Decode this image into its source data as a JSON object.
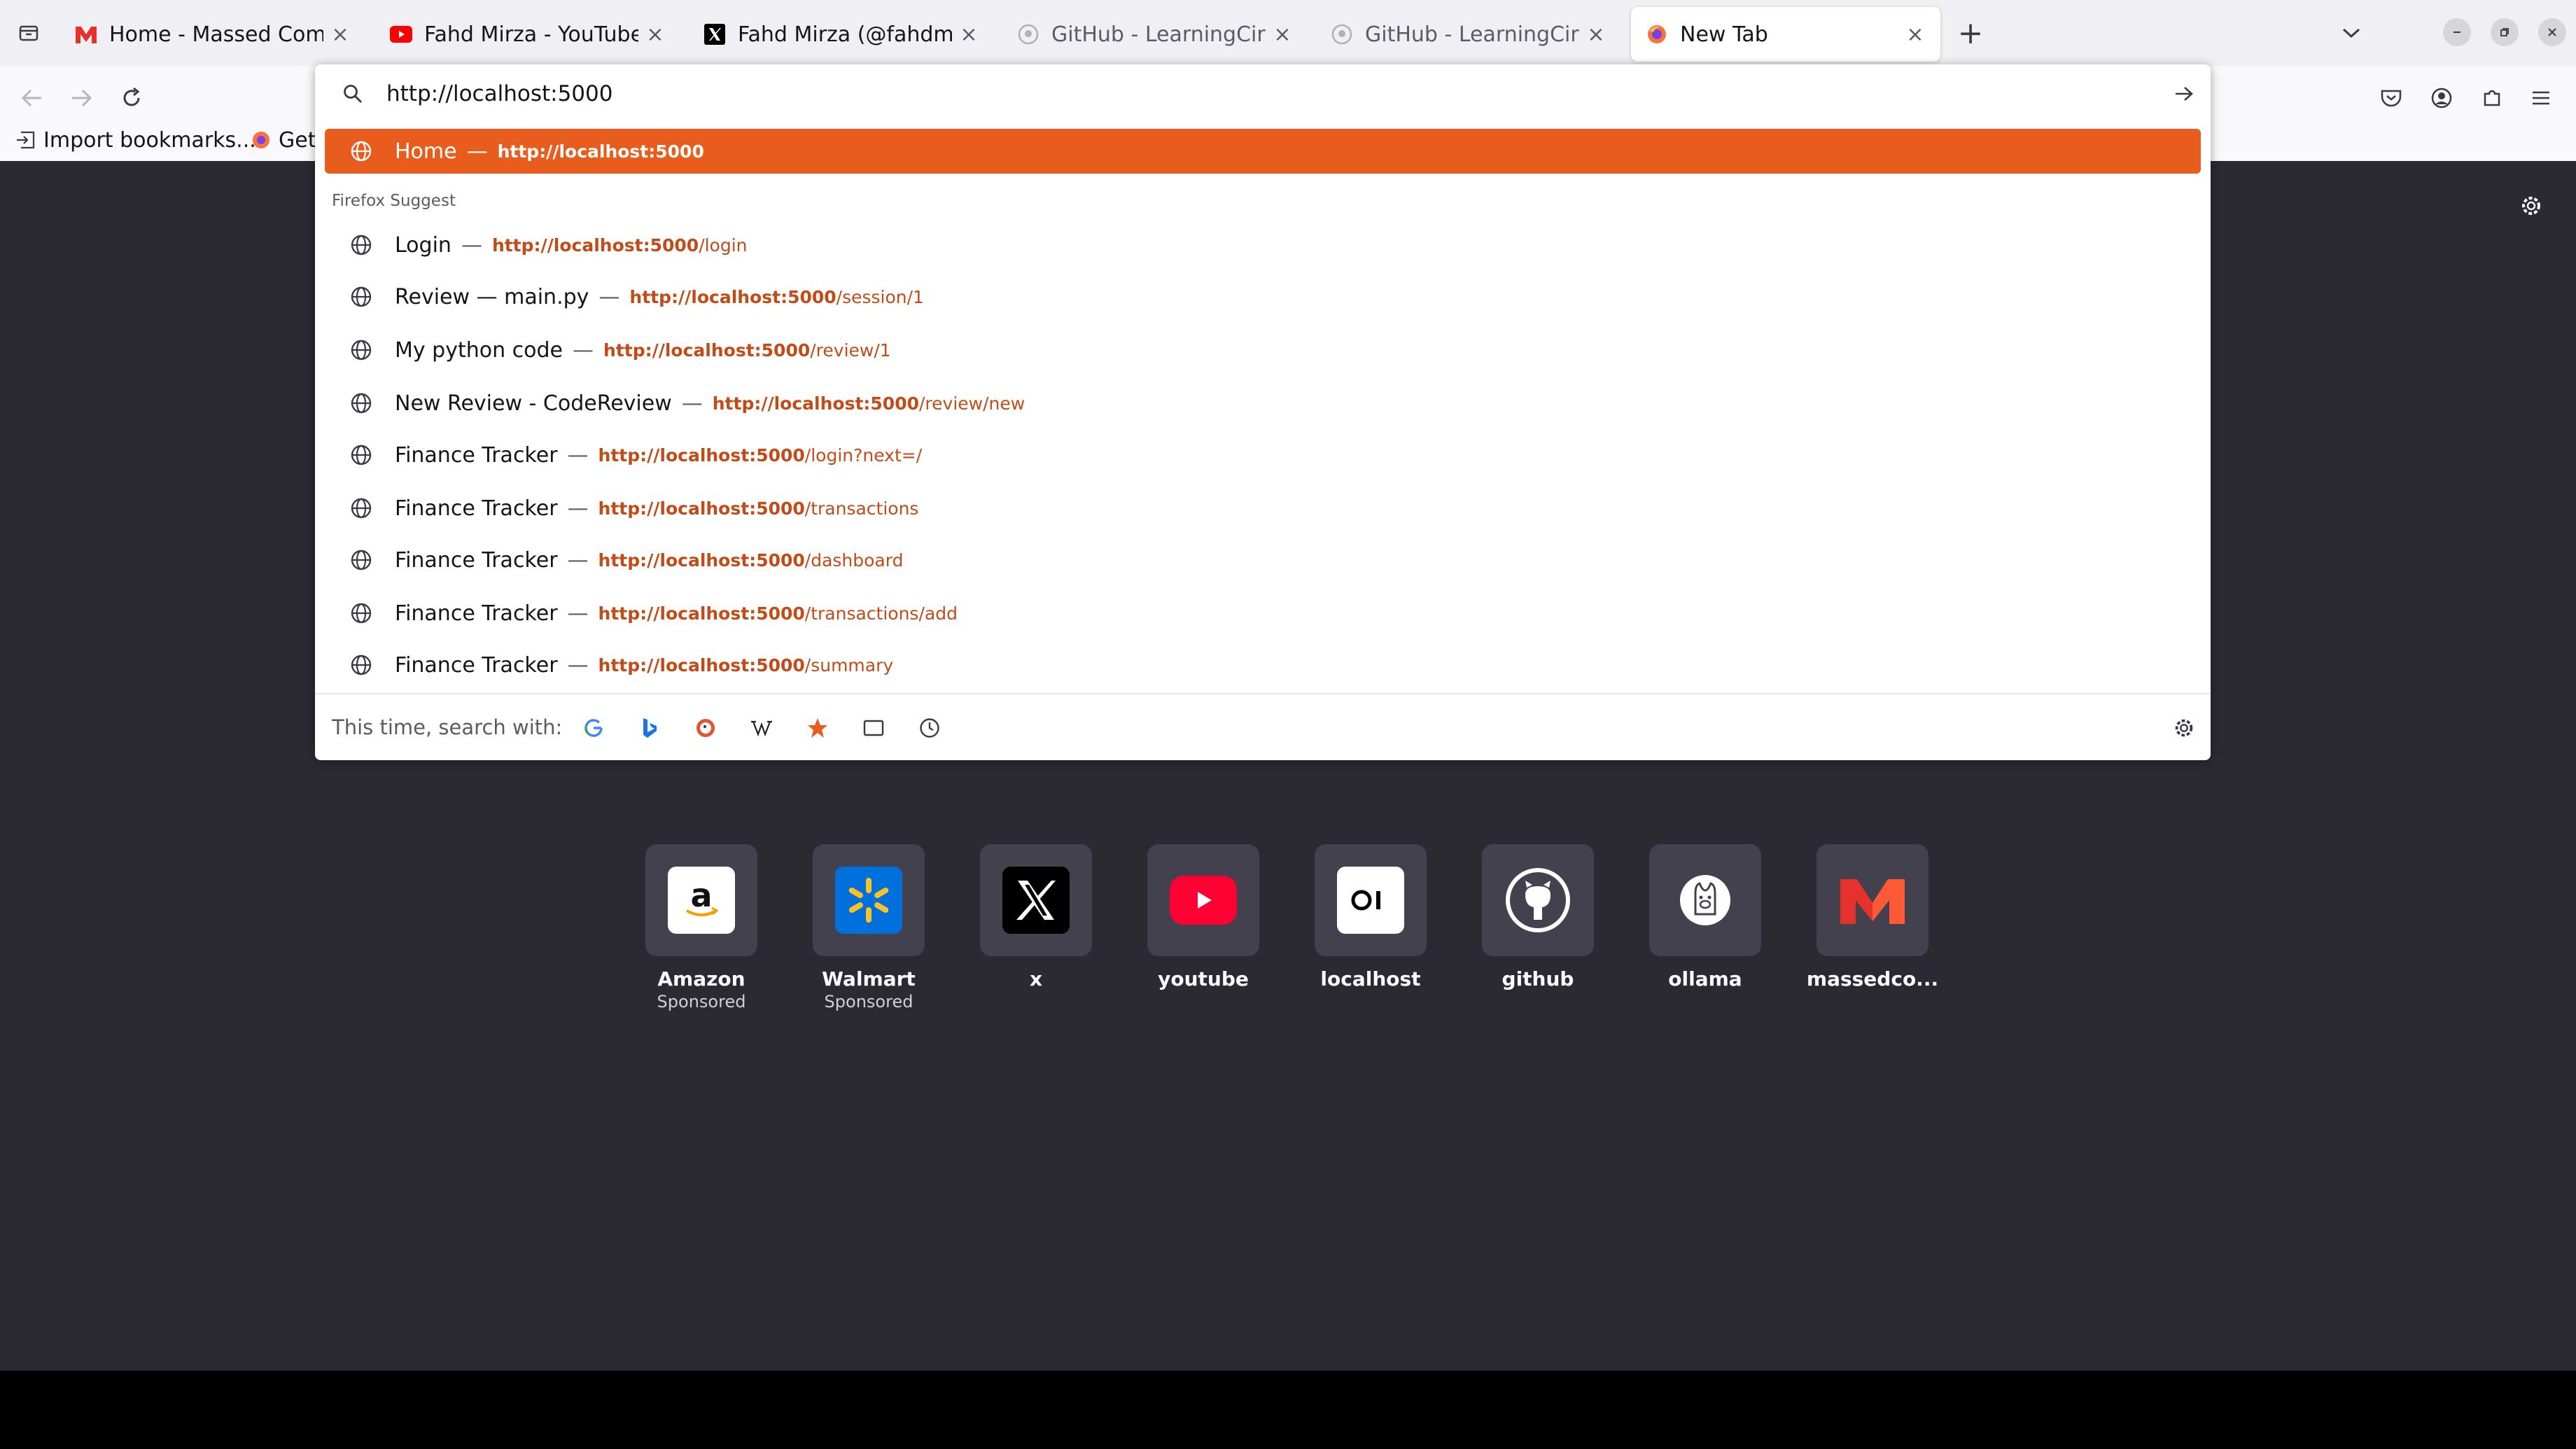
{
  "tabs": [
    {
      "title": "Home - Massed Compute",
      "favicon": "massed-compute-logo",
      "active": false
    },
    {
      "title": "Fahd Mirza - YouTube",
      "favicon": "youtube-logo",
      "active": false
    },
    {
      "title": "Fahd Mirza (@fahdmirza)",
      "favicon": "x-logo",
      "active": false
    },
    {
      "title": "GitHub - LearningCircuit/",
      "favicon": "github-logo",
      "active": false
    },
    {
      "title": "GitHub - LearningCircuit/",
      "favicon": "github-logo",
      "active": false
    },
    {
      "title": "New Tab",
      "favicon": "firefox-logo",
      "active": true
    }
  ],
  "bookmarks": [
    {
      "label": "Import bookmarks...",
      "icon": "import-icon"
    },
    {
      "label": "Get",
      "icon": "firefox-logo"
    }
  ],
  "urlbar": {
    "value": "http://localhost:5000",
    "heuristic": {
      "title": "Home",
      "url_host": "http://localhost:5000",
      "url_path": ""
    },
    "group_label": "Firefox Suggest",
    "suggestions": [
      {
        "title": "Login",
        "url_host": "http://localhost:5000",
        "url_path": "/login"
      },
      {
        "title": "Review — main.py",
        "url_host": "http://localhost:5000",
        "url_path": "/session/1"
      },
      {
        "title": "My python code",
        "url_host": "http://localhost:5000",
        "url_path": "/review/1"
      },
      {
        "title": "New Review - CodeReview",
        "url_host": "http://localhost:5000",
        "url_path": "/review/new"
      },
      {
        "title": "Finance Tracker",
        "url_host": "http://localhost:5000",
        "url_path": "/login?next=/"
      },
      {
        "title": "Finance Tracker",
        "url_host": "http://localhost:5000",
        "url_path": "/transactions"
      },
      {
        "title": "Finance Tracker",
        "url_host": "http://localhost:5000",
        "url_path": "/dashboard"
      },
      {
        "title": "Finance Tracker",
        "url_host": "http://localhost:5000",
        "url_path": "/transactions/add"
      },
      {
        "title": "Finance Tracker",
        "url_host": "http://localhost:5000",
        "url_path": "/summary"
      }
    ],
    "separator": "—",
    "search_with_label": "This time, search with:",
    "engines": [
      "google",
      "bing",
      "duckduckgo",
      "wikipedia",
      "bookmarks",
      "tabs",
      "history"
    ]
  },
  "shortcuts": [
    {
      "label": "Amazon",
      "sub": "Sponsored",
      "icon": "amazon-logo"
    },
    {
      "label": "Walmart",
      "sub": "Sponsored",
      "icon": "walmart-logo"
    },
    {
      "label": "x",
      "sub": "",
      "icon": "x-logo"
    },
    {
      "label": "youtube",
      "sub": "",
      "icon": "youtube-logo"
    },
    {
      "label": "localhost",
      "sub": "",
      "icon": "localhost-logo"
    },
    {
      "label": "github",
      "sub": "",
      "icon": "github-logo"
    },
    {
      "label": "ollama",
      "sub": "",
      "icon": "ollama-logo"
    },
    {
      "label": "massedco...",
      "sub": "",
      "icon": "massed-compute-logo"
    }
  ],
  "colors": {
    "accent": "#e85d1d",
    "url_text": "#c24b17",
    "page_bg": "#2b2a33",
    "tile_bg": "#42414d"
  }
}
